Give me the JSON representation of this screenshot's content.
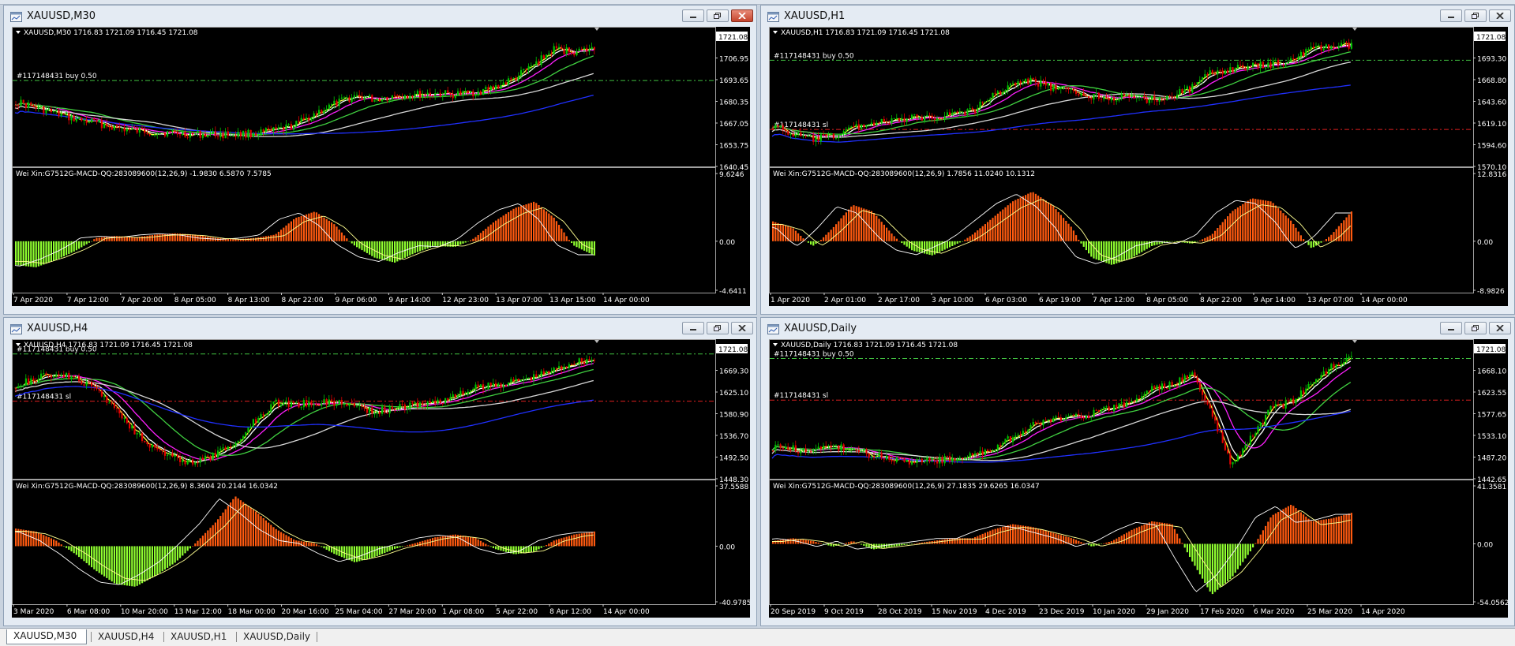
{
  "windows": [
    {
      "id": "m30",
      "title": "XAUUSD,M30",
      "active": true,
      "header": "XAUUSD,M30  1716.83 1721.09 1716.45 1721.08",
      "price_axis": [
        "1721.08",
        "1706.95",
        "1693.65",
        "1680.35",
        "1667.05",
        "1653.75",
        "1640.45"
      ],
      "order_lines": [
        {
          "label": "#117148431 buy 0.50",
          "kind": "buy",
          "value": 1693.65
        }
      ],
      "macd_label": "Wei Xin:G7512G-MACD-QQ:283089600(12,26,9) -1.9830 6.5870 7.5785",
      "macd_axis": [
        "9.6246",
        "0.00",
        "-4.6411"
      ],
      "time_axis": [
        "7 Apr 2020",
        "7 Apr 12:00",
        "7 Apr 20:00",
        "8 Apr 05:00",
        "8 Apr 13:00",
        "8 Apr 22:00",
        "9 Apr 06:00",
        "9 Apr 14:00",
        "12 Apr 23:00",
        "13 Apr 07:00",
        "13 Apr 15:00",
        "14 Apr 00:00"
      ],
      "shape": [
        0.5,
        0.45,
        0.4,
        0.35,
        0.32,
        0.28,
        0.25,
        0.24,
        0.23,
        0.22,
        0.22,
        0.22,
        0.23,
        0.25,
        0.3,
        0.4,
        0.48,
        0.55,
        0.52,
        0.55,
        0.56,
        0.57,
        0.56,
        0.58,
        0.62,
        0.7,
        0.82,
        0.95,
        0.93,
        0.95
      ],
      "macd_shape": [
        -0.5,
        -0.55,
        -0.4,
        -0.2,
        0.05,
        0.08,
        0.06,
        0.1,
        0.12,
        0.1,
        0.05,
        0.03,
        0.05,
        0.1,
        0.35,
        0.45,
        0.25,
        -0.1,
        -0.35,
        -0.45,
        -0.25,
        -0.1,
        -0.12,
        0.05,
        0.3,
        0.5,
        0.6,
        0.35,
        -0.1,
        -0.3
      ],
      "macd_zero": 0.58
    },
    {
      "id": "h1",
      "title": "XAUUSD,H1",
      "active": false,
      "header": "XAUUSD,H1  1716.83 1721.09 1716.45 1721.08",
      "price_axis": [
        "1721.08",
        "1693.30",
        "1668.80",
        "1643.60",
        "1619.10",
        "1594.60",
        "1570.10"
      ],
      "order_lines": [
        {
          "label": "#117148431 buy 0.50",
          "kind": "buy",
          "value": 1693.3
        },
        {
          "label": "#117148431 sl",
          "kind": "sl",
          "value": 1613.0
        }
      ],
      "macd_label": "Wei Xin:G7512G-MACD-QQ:283089600(12,26,9) 1.7856 11.0240 10.1312",
      "macd_axis": [
        "12.8316",
        "0.00",
        "-8.9826"
      ],
      "time_axis": [
        "1 Apr 2020",
        "2 Apr 01:00",
        "2 Apr 17:00",
        "3 Apr 10:00",
        "6 Apr 03:00",
        "6 Apr 19:00",
        "7 Apr 12:00",
        "8 Apr 05:00",
        "8 Apr 22:00",
        "9 Apr 14:00",
        "13 Apr 07:00",
        "14 Apr 00:00"
      ],
      "shape": [
        0.3,
        0.22,
        0.18,
        0.2,
        0.28,
        0.32,
        0.33,
        0.36,
        0.37,
        0.4,
        0.42,
        0.55,
        0.65,
        0.68,
        0.62,
        0.58,
        0.55,
        0.54,
        0.53,
        0.52,
        0.55,
        0.62,
        0.75,
        0.78,
        0.8,
        0.82,
        0.86,
        0.95,
        0.97,
        0.98
      ],
      "macd_shape": [
        0.3,
        0.2,
        -0.1,
        0.2,
        0.55,
        0.45,
        0.1,
        -0.2,
        -0.3,
        -0.1,
        0.1,
        0.35,
        0.6,
        0.75,
        0.55,
        0.2,
        -0.35,
        -0.5,
        -0.35,
        -0.1,
        0.0,
        -0.05,
        0.1,
        0.45,
        0.65,
        0.6,
        0.3,
        -0.15,
        0.1,
        0.45
      ],
      "macd_zero": 0.58
    },
    {
      "id": "h4",
      "title": "XAUUSD,H4",
      "active": false,
      "header": "XAUUSD,H4  1716.83 1721.09 1716.45 1721.08",
      "price_axis": [
        "1721.08",
        "1669.30",
        "1625.10",
        "1580.90",
        "1536.70",
        "1492.50",
        "1448.30"
      ],
      "order_lines": [
        {
          "label": "#117148431 buy 0.50",
          "kind": "buy",
          "value": 1710.0
        },
        {
          "label": "#117148431 sl",
          "kind": "sl",
          "value": 1611.0
        }
      ],
      "macd_label": "Wei Xin:G7512G-MACD-QQ:283089600(12,26,9) 8.3604 20.2144 16.0342",
      "macd_axis": [
        "37.5588",
        "0.00",
        "-40.9785"
      ],
      "time_axis": [
        "3 Mar 2020",
        "6 Mar 08:00",
        "10 Mar 20:00",
        "13 Mar 12:00",
        "18 Mar 00:00",
        "20 Mar 16:00",
        "25 Mar 04:00",
        "27 Mar 20:00",
        "1 Apr 08:00",
        "5 Apr 22:00",
        "8 Apr 12:00",
        "14 Apr 00:00"
      ],
      "shape": [
        0.75,
        0.8,
        0.85,
        0.8,
        0.72,
        0.55,
        0.35,
        0.2,
        0.12,
        0.08,
        0.15,
        0.25,
        0.45,
        0.6,
        0.58,
        0.6,
        0.6,
        0.58,
        0.52,
        0.55,
        0.58,
        0.6,
        0.65,
        0.72,
        0.75,
        0.78,
        0.82,
        0.88,
        0.95,
        0.97
      ],
      "macd_shape": [
        0.3,
        0.25,
        0.1,
        -0.15,
        -0.45,
        -0.7,
        -0.75,
        -0.55,
        -0.3,
        0.05,
        0.4,
        0.85,
        0.6,
        0.3,
        0.1,
        0.05,
        -0.15,
        -0.3,
        -0.2,
        -0.05,
        0.05,
        0.15,
        0.2,
        0.15,
        -0.05,
        -0.15,
        -0.1,
        0.1,
        0.2,
        0.25
      ],
      "macd_zero": 0.52
    },
    {
      "id": "daily",
      "title": "XAUUSD,Daily",
      "active": false,
      "header": "XAUUSD,Daily  1716.83 1721.09 1716.45 1721.08",
      "price_axis": [
        "1721.08",
        "1668.10",
        "1623.55",
        "1577.65",
        "1533.10",
        "1487.20",
        "1442.65"
      ],
      "order_lines": [
        {
          "label": "#117148431 buy 0.50",
          "kind": "buy",
          "value": 1700.0
        },
        {
          "label": "#117148431 sl",
          "kind": "sl",
          "value": 1611.0
        }
      ],
      "macd_label": "Wei Xin:G7512G-MACD-QQ:283089600(12,26,9) 27.1835 29.6265 16.0347",
      "macd_axis": [
        "41.3581",
        "0.00",
        "-54.0562"
      ],
      "time_axis": [
        "20 Sep 2019",
        "9 Oct 2019",
        "28 Oct 2019",
        "15 Nov 2019",
        "4 Dec 2019",
        "23 Dec 2019",
        "10 Jan 2020",
        "29 Jan 2020",
        "17 Feb 2020",
        "6 Mar 2020",
        "25 Mar 2020",
        "14 Apr 2020"
      ],
      "shape": [
        0.22,
        0.2,
        0.18,
        0.22,
        0.2,
        0.15,
        0.12,
        0.1,
        0.1,
        0.12,
        0.14,
        0.2,
        0.3,
        0.4,
        0.45,
        0.48,
        0.5,
        0.55,
        0.6,
        0.72,
        0.75,
        0.85,
        0.5,
        0.05,
        0.3,
        0.55,
        0.6,
        0.75,
        0.92,
        0.98
      ],
      "macd_shape": [
        0.05,
        0.1,
        0.05,
        -0.05,
        0.05,
        -0.1,
        -0.05,
        0.0,
        0.05,
        0.1,
        0.1,
        0.25,
        0.35,
        0.3,
        0.2,
        0.1,
        -0.05,
        0.05,
        0.25,
        0.4,
        0.35,
        -0.3,
        -0.9,
        -0.6,
        -0.1,
        0.5,
        0.7,
        0.4,
        0.45,
        0.55
      ],
      "macd_zero": 0.5
    }
  ],
  "tabs": [
    "XAUUSD,M30",
    "XAUUSD,H4",
    "XAUUSD,H1",
    "XAUUSD,Daily"
  ],
  "active_tab": "XAUUSD,M30",
  "colors": {
    "bull": "#00c000",
    "bear": "#e00000",
    "ma_fast": "#ffff40",
    "ma_white": "#ffffff",
    "ma_magenta": "#ff20ff",
    "ma_green": "#40d040",
    "ma_gray": "#d8d8d8",
    "ma_blue": "#2030ff",
    "hist_up": "#ff5a10",
    "hist_down": "#90ff30",
    "buy_line": "#40c040",
    "sl_line": "#e02020",
    "axis_text": "#ffffff"
  }
}
